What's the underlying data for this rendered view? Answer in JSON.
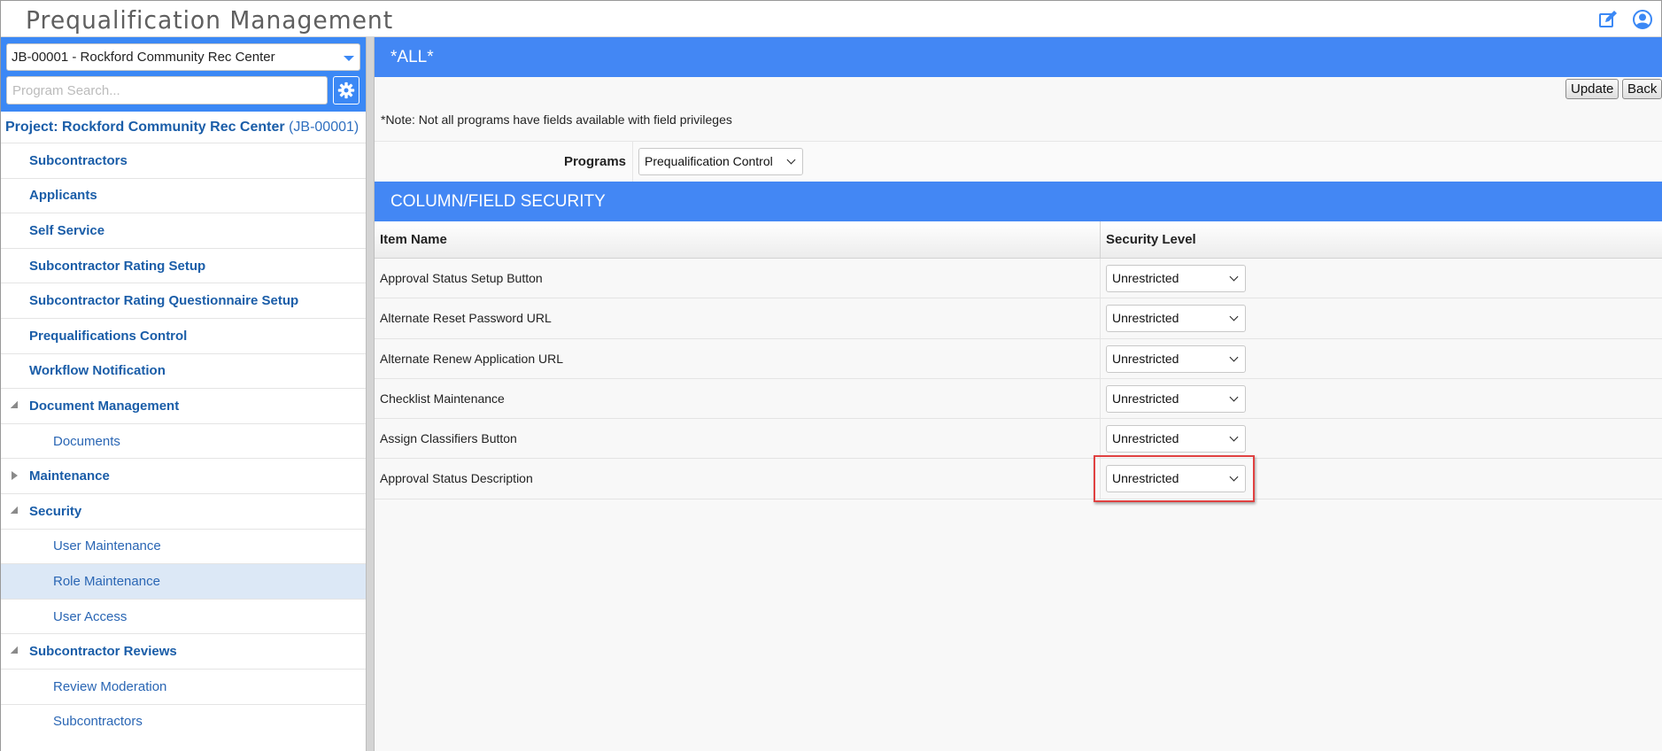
{
  "app": {
    "title": "Prequalification Management"
  },
  "header_icons": {
    "edit": "edit-pencil-icon",
    "user": "user-profile-icon"
  },
  "left": {
    "project_select_value": "JB-00001 - Rockford Community Rec Center",
    "search_placeholder": "Program Search...",
    "project_prefix": "Project: Rockford Community Rec Center",
    "project_code": "(JB-00001)",
    "nav": [
      {
        "label": "Subcontractors",
        "level": 0
      },
      {
        "label": "Applicants",
        "level": 0
      },
      {
        "label": "Self Service",
        "level": 0
      },
      {
        "label": "Subcontractor Rating Setup",
        "level": 0
      },
      {
        "label": "Subcontractor Rating Questionnaire Setup",
        "level": 0
      },
      {
        "label": "Prequalifications Control",
        "level": 0
      },
      {
        "label": "Workflow Notification",
        "level": 0
      },
      {
        "label": "Document Management",
        "level": 0,
        "expander": "open"
      },
      {
        "label": "Documents",
        "level": 1
      },
      {
        "label": "Maintenance",
        "level": 0,
        "expander": "closed"
      },
      {
        "label": "Security",
        "level": 0,
        "expander": "open"
      },
      {
        "label": "User Maintenance",
        "level": 1
      },
      {
        "label": "Role Maintenance",
        "level": 1,
        "selected": true
      },
      {
        "label": "User Access",
        "level": 1
      },
      {
        "label": "Subcontractor Reviews",
        "level": 0,
        "expander": "open"
      },
      {
        "label": "Review Moderation",
        "level": 1
      },
      {
        "label": "Subcontractors",
        "level": 1
      }
    ]
  },
  "main": {
    "band_title": "*ALL*",
    "update_label": "Update",
    "back_label": "Back",
    "note": "*Note: Not all programs have fields available with field privileges",
    "programs_label": "Programs",
    "programs_value": "Prequalification Control",
    "section_title": "COLUMN/FIELD SECURITY",
    "columns": {
      "item": "Item Name",
      "level": "Security Level"
    },
    "rows": [
      {
        "name": "Approval Status Setup Button",
        "level": "Unrestricted"
      },
      {
        "name": "Alternate Reset Password URL",
        "level": "Unrestricted"
      },
      {
        "name": "Alternate Renew Application URL",
        "level": "Unrestricted"
      },
      {
        "name": "Checklist Maintenance",
        "level": "Unrestricted"
      },
      {
        "name": "Assign Classifiers Button",
        "level": "Unrestricted"
      },
      {
        "name": "Approval Status Description",
        "level": "Unrestricted",
        "highlighted": true
      }
    ]
  },
  "colors": {
    "accent": "#4387f4",
    "nav_text": "#1a5da8",
    "selected_row": "#dce8f6",
    "highlight": "#e04141"
  }
}
